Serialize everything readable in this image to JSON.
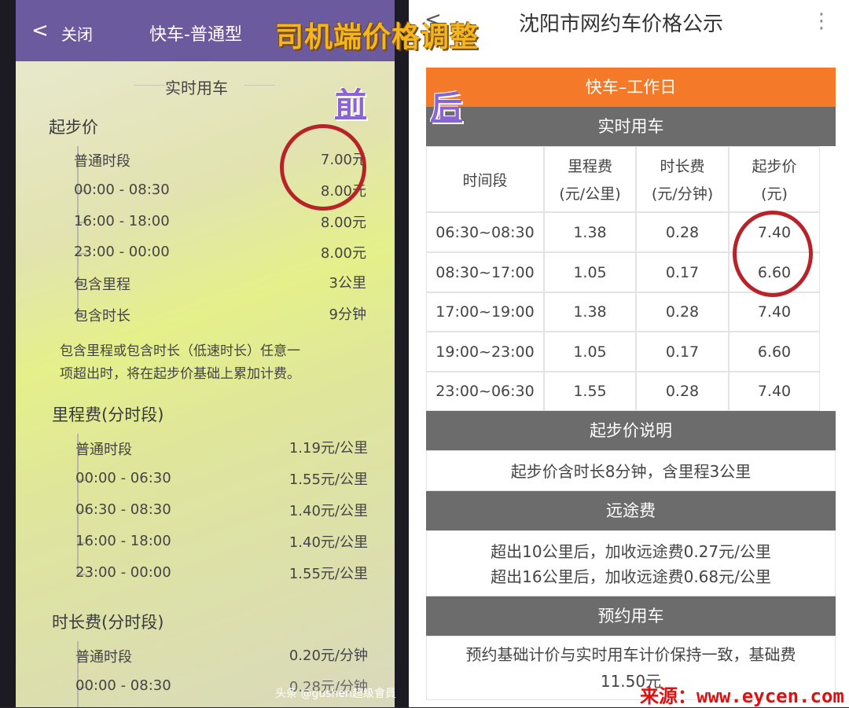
{
  "overlay": {
    "title": "司机端价格调整",
    "before_tag": "前",
    "after_tag": "后",
    "watermark": "头条 @gushen超级會員",
    "source": "来源：www.eycen.com"
  },
  "phone": {
    "header": {
      "back": "<",
      "close": "关闭",
      "title": "快车-普通型"
    },
    "section_title": "实时用车",
    "start_price": {
      "heading": "起步价",
      "rows": [
        {
          "label": "普通时段",
          "value": "7.00元"
        },
        {
          "label": "00:00 - 08:30",
          "value": "8.00元"
        },
        {
          "label": "16:00 - 18:00",
          "value": "8.00元"
        },
        {
          "label": "23:00 - 00:00",
          "value": "8.00元"
        },
        {
          "label": "包含里程",
          "value": "3公里"
        },
        {
          "label": "包含时长",
          "value": "9分钟"
        }
      ],
      "note_line1": "包含里程或包含时长（低速时长）任意一",
      "note_line2": "项超出时，将在起步价基础上累加计费。"
    },
    "mileage": {
      "heading": "里程费(分时段)",
      "rows": [
        {
          "label": "普通时段",
          "value": "1.19元/公里"
        },
        {
          "label": "00:00 - 06:30",
          "value": "1.55元/公里"
        },
        {
          "label": "06:30 - 08:30",
          "value": "1.40元/公里"
        },
        {
          "label": "16:00 - 18:00",
          "value": "1.40元/公里"
        },
        {
          "label": "23:00 - 00:00",
          "value": "1.55元/公里"
        }
      ]
    },
    "duration": {
      "heading": "时长费(分时段)",
      "rows": [
        {
          "label": "普通时段",
          "value": "0.20元/分钟"
        },
        {
          "label": "00:00 - 08:30",
          "value": "0.28元/分钟"
        }
      ]
    }
  },
  "page": {
    "title": "沈阳市网约车价格公示",
    "back": "<",
    "more": "⋮",
    "banner": "快车–工作日",
    "realtime": "实时用车",
    "headers": [
      {
        "l1": "时间段",
        "l2": ""
      },
      {
        "l1": "里程费",
        "l2": "(元/公里)"
      },
      {
        "l1": "时长费",
        "l2": "(元/分钟)"
      },
      {
        "l1": "起步价",
        "l2": "(元)"
      }
    ],
    "rows": [
      [
        "06:30~08:30",
        "1.38",
        "0.28",
        "7.40"
      ],
      [
        "08:30~17:00",
        "1.05",
        "0.17",
        "6.60"
      ],
      [
        "17:00~19:00",
        "1.38",
        "0.28",
        "7.40"
      ],
      [
        "19:00~23:00",
        "1.05",
        "0.17",
        "6.60"
      ],
      [
        "23:00~06:30",
        "1.55",
        "0.28",
        "7.40"
      ]
    ],
    "start_note_title": "起步价说明",
    "start_note": "起步价含时长8分钟，含里程3公里",
    "long_title": "远途费",
    "long_line1": "超出10公里后，加收远途费0.27元/公里",
    "long_line2": "超出16公里后，加收远途费0.68元/公里",
    "reserve_title": "预约用车",
    "reserve_line1": "预约基础计价与实时用车计价保持一致，基础费",
    "reserve_line2": "11.50元"
  },
  "colors": {
    "accent_orange": "#f47a2a",
    "header_gray": "#6c6c6c",
    "circle_red": "#b8232a",
    "phone_header": "#6c5a9e"
  }
}
